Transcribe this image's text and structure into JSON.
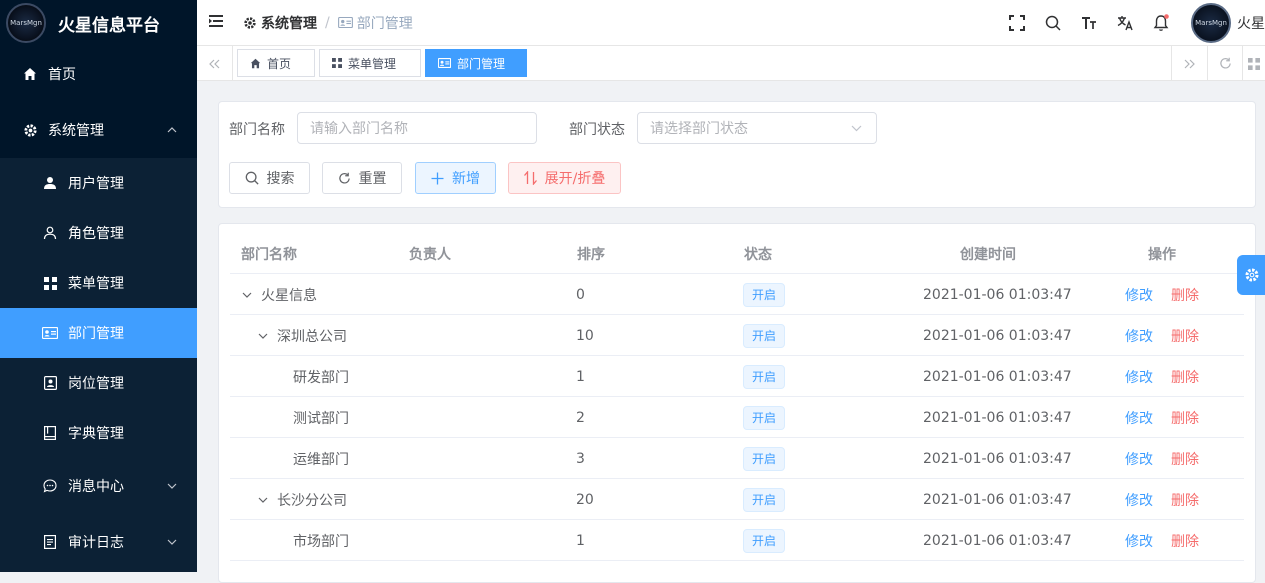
{
  "app": {
    "title": "火星信息平台",
    "logo_text": "MarsMgn"
  },
  "sidebar": {
    "home": "首页",
    "system": "系统管理",
    "items": [
      {
        "label": "用户管理"
      },
      {
        "label": "角色管理"
      },
      {
        "label": "菜单管理"
      },
      {
        "label": "部门管理"
      },
      {
        "label": "岗位管理"
      },
      {
        "label": "字典管理"
      },
      {
        "label": "消息中心"
      },
      {
        "label": "审计日志"
      }
    ]
  },
  "header": {
    "breadcrumb": {
      "parent": "系统管理",
      "current": "部门管理",
      "separator": "/"
    },
    "user_name": "火星",
    "avatar_text": "MarsMgn"
  },
  "tags": [
    {
      "label": "首页"
    },
    {
      "label": "菜单管理"
    },
    {
      "label": "部门管理"
    }
  ],
  "search": {
    "dept_name_label": "部门名称",
    "dept_name_placeholder": "请输入部门名称",
    "dept_status_label": "部门状态",
    "dept_status_placeholder": "请选择部门状态",
    "search_btn": "搜索",
    "reset_btn": "重置",
    "add_btn": "新增",
    "toggle_btn": "展开/折叠"
  },
  "table": {
    "columns": [
      "部门名称",
      "负责人",
      "排序",
      "状态",
      "创建时间",
      "操作"
    ],
    "edit_label": "修改",
    "delete_label": "删除",
    "rows": [
      {
        "name": "火星信息",
        "leader": "",
        "sort": "0",
        "status": "开启",
        "created": "2021-01-06 01:03:47",
        "level": 0,
        "expandable": true
      },
      {
        "name": "深圳总公司",
        "leader": "",
        "sort": "10",
        "status": "开启",
        "created": "2021-01-06 01:03:47",
        "level": 1,
        "expandable": true
      },
      {
        "name": "研发部门",
        "leader": "",
        "sort": "1",
        "status": "开启",
        "created": "2021-01-06 01:03:47",
        "level": 2,
        "expandable": false
      },
      {
        "name": "测试部门",
        "leader": "",
        "sort": "2",
        "status": "开启",
        "created": "2021-01-06 01:03:47",
        "level": 2,
        "expandable": false
      },
      {
        "name": "运维部门",
        "leader": "",
        "sort": "3",
        "status": "开启",
        "created": "2021-01-06 01:03:47",
        "level": 2,
        "expandable": false
      },
      {
        "name": "长沙分公司",
        "leader": "",
        "sort": "20",
        "status": "开启",
        "created": "2021-01-06 01:03:47",
        "level": 1,
        "expandable": true
      },
      {
        "name": "市场部门",
        "leader": "",
        "sort": "1",
        "status": "开启",
        "created": "2021-01-06 01:03:47",
        "level": 2,
        "expandable": false
      }
    ]
  },
  "colors": {
    "sidebar_bg": "#001529",
    "accent": "#409eff",
    "danger": "#f56c6c"
  }
}
